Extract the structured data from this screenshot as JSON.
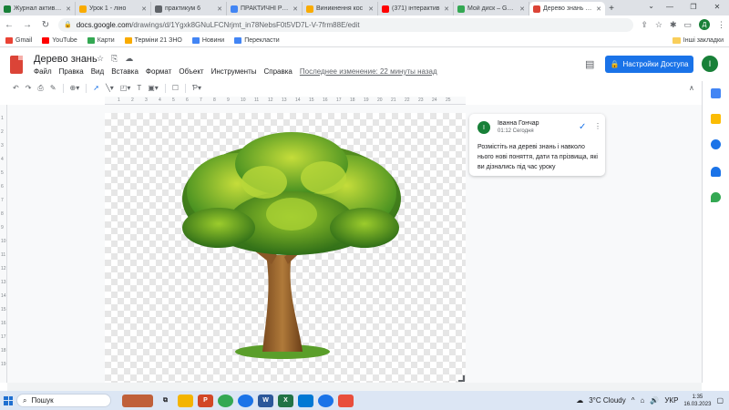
{
  "tabs": [
    {
      "title": "Журнал активнос",
      "color": "#188038",
      "active": false
    },
    {
      "title": "Урок 1 - ліно",
      "color": "#f9ab00",
      "active": false
    },
    {
      "title": "практикум 6",
      "color": "#5f6368",
      "active": false
    },
    {
      "title": "ПРАКТИЧНІ РОБ",
      "color": "#4285f4",
      "active": false
    },
    {
      "title": "Виникнення кос",
      "color": "#f9ab00",
      "active": false
    },
    {
      "title": "(371) інтерактив",
      "color": "#ff0000",
      "active": false
    },
    {
      "title": "Мой диск – Goog",
      "color": "#34a853",
      "active": false
    },
    {
      "title": "Дерево знань - G",
      "color": "#db4437",
      "active": true
    }
  ],
  "browser": {
    "url_domain": "docs.google.com",
    "url_path": "/drawings/d/1Ygxk8GNuLFCNrjmt_in78NebsF0t5VD7L-V-7frm88E/edit",
    "profile_letter": "Д"
  },
  "bookmarks": [
    {
      "label": "Gmail",
      "color": "#ea4335"
    },
    {
      "label": "YouTube",
      "color": "#ff0000"
    },
    {
      "label": "Карти",
      "color": "#34a853"
    },
    {
      "label": "Терміни 21 ЗНО",
      "color": "#f9ab00"
    },
    {
      "label": "Новини",
      "color": "#4285f4"
    },
    {
      "label": "Перекласти",
      "color": "#4285f4"
    }
  ],
  "bookmarks_other": "Інші закладки",
  "doc": {
    "title": "Дерево знань",
    "menus": [
      "Файл",
      "Правка",
      "Вид",
      "Вставка",
      "Формат",
      "Объект",
      "Инструменты",
      "Справка"
    ],
    "last_edit": "Последнее изменение: 22 минуты назад",
    "share_label": "Настройки Доступа",
    "user_letter": "І"
  },
  "ruler_numbers": [
    "1",
    "2",
    "3",
    "4",
    "5",
    "6",
    "7",
    "8",
    "9",
    "10",
    "11",
    "12",
    "13",
    "14",
    "15",
    "16",
    "17",
    "18",
    "19",
    "20",
    "21",
    "22",
    "23",
    "24",
    "25"
  ],
  "comment": {
    "avatar": "І",
    "author": "Іванна Гончар",
    "time": "01:12 Сегодня",
    "text": "Розмістіть на дереві знань і навколо нього нові поняття, дати та прізвища, які ви дізнались під час уроку"
  },
  "taskbar": {
    "search_label": "Пошук",
    "weather": "3°C  Cloudy",
    "language": "УКР",
    "time": "1:35",
    "date": "16.03.2023"
  },
  "colors": {
    "accent": "#1a73e8",
    "green": "#188038",
    "docs_red": "#db4437"
  }
}
